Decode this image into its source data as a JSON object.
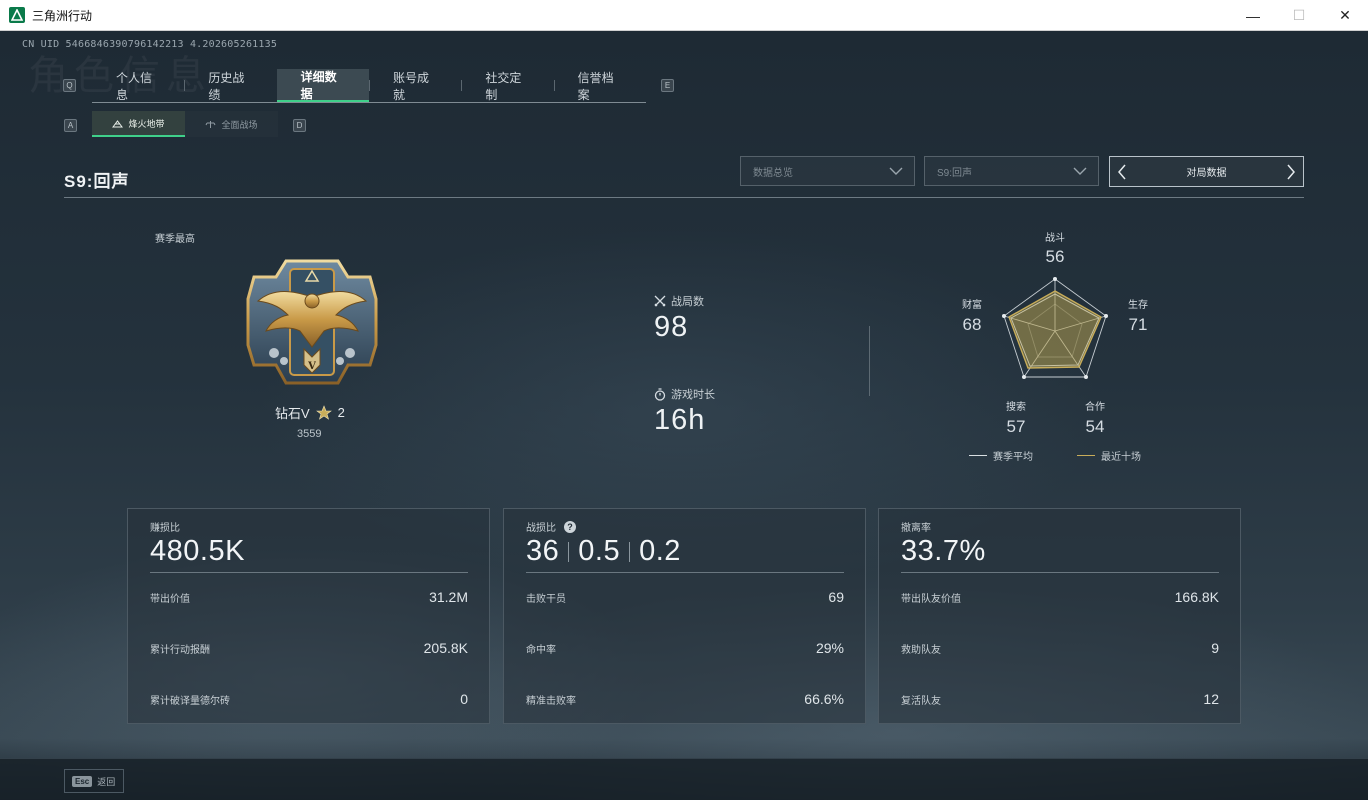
{
  "window": {
    "title": "三角洲行动",
    "minimize": "—",
    "maximize": "☐",
    "close": "✕"
  },
  "uid": "CN UID 5466846390796142213 4.202605261135",
  "watermark": "角色信息",
  "keyhints": {
    "tabs_left": "Q",
    "tabs_right": "E",
    "sub_left": "A",
    "sub_right": "D"
  },
  "tabs": [
    {
      "label": "个人信息"
    },
    {
      "label": "历史战绩"
    },
    {
      "label": "详细数据"
    },
    {
      "label": "账号成就"
    },
    {
      "label": "社交定制"
    },
    {
      "label": "信誉档案"
    }
  ],
  "subtabs": [
    {
      "label": "烽火地带",
      "icon": "beacon-icon"
    },
    {
      "label": "全面战场",
      "icon": "battlefield-icon"
    }
  ],
  "season_title": "S9:回声",
  "filters": {
    "data_overview": "数据总览",
    "season": "S9:回声",
    "match_data": "对局数据"
  },
  "rank": {
    "label": "赛季最高",
    "name": "钻石V",
    "stars": "2",
    "score": "3559"
  },
  "stats": {
    "matches_label": "战局数",
    "matches": "98",
    "playtime_label": "游戏时长",
    "playtime": "16h"
  },
  "radar": {
    "axes": [
      {
        "label": "战斗",
        "value": "56"
      },
      {
        "label": "生存",
        "value": "71"
      },
      {
        "label": "合作",
        "value": "54"
      },
      {
        "label": "搜索",
        "value": "57"
      },
      {
        "label": "财富",
        "value": "68"
      }
    ],
    "legend": [
      {
        "label": "赛季平均",
        "color": "#d9dfe3"
      },
      {
        "label": "最近十场",
        "color": "#c8ad5a"
      }
    ]
  },
  "cards": {
    "profit": {
      "title": "赚损比",
      "big": "480.5K",
      "rows": [
        {
          "k": "带出价值",
          "v": "31.2M"
        },
        {
          "k": "累计行动报酬",
          "v": "205.8K"
        },
        {
          "k": "累计破译量德尔砖",
          "v": "0"
        }
      ]
    },
    "combat": {
      "title": "战损比",
      "big": [
        "36",
        "0.5",
        "0.2"
      ],
      "help": "?",
      "rows": [
        {
          "k": "击败干员",
          "v": "69"
        },
        {
          "k": "命中率",
          "v": "29%"
        },
        {
          "k": "精准击败率",
          "v": "66.6%"
        }
      ]
    },
    "extract": {
      "title": "撤离率",
      "big": "33.7%",
      "rows": [
        {
          "k": "带出队友价值",
          "v": "166.8K"
        },
        {
          "k": "救助队友",
          "v": "9"
        },
        {
          "k": "复活队友",
          "v": "12"
        }
      ]
    }
  },
  "footer": {
    "esc": "Esc",
    "back": "返回"
  }
}
